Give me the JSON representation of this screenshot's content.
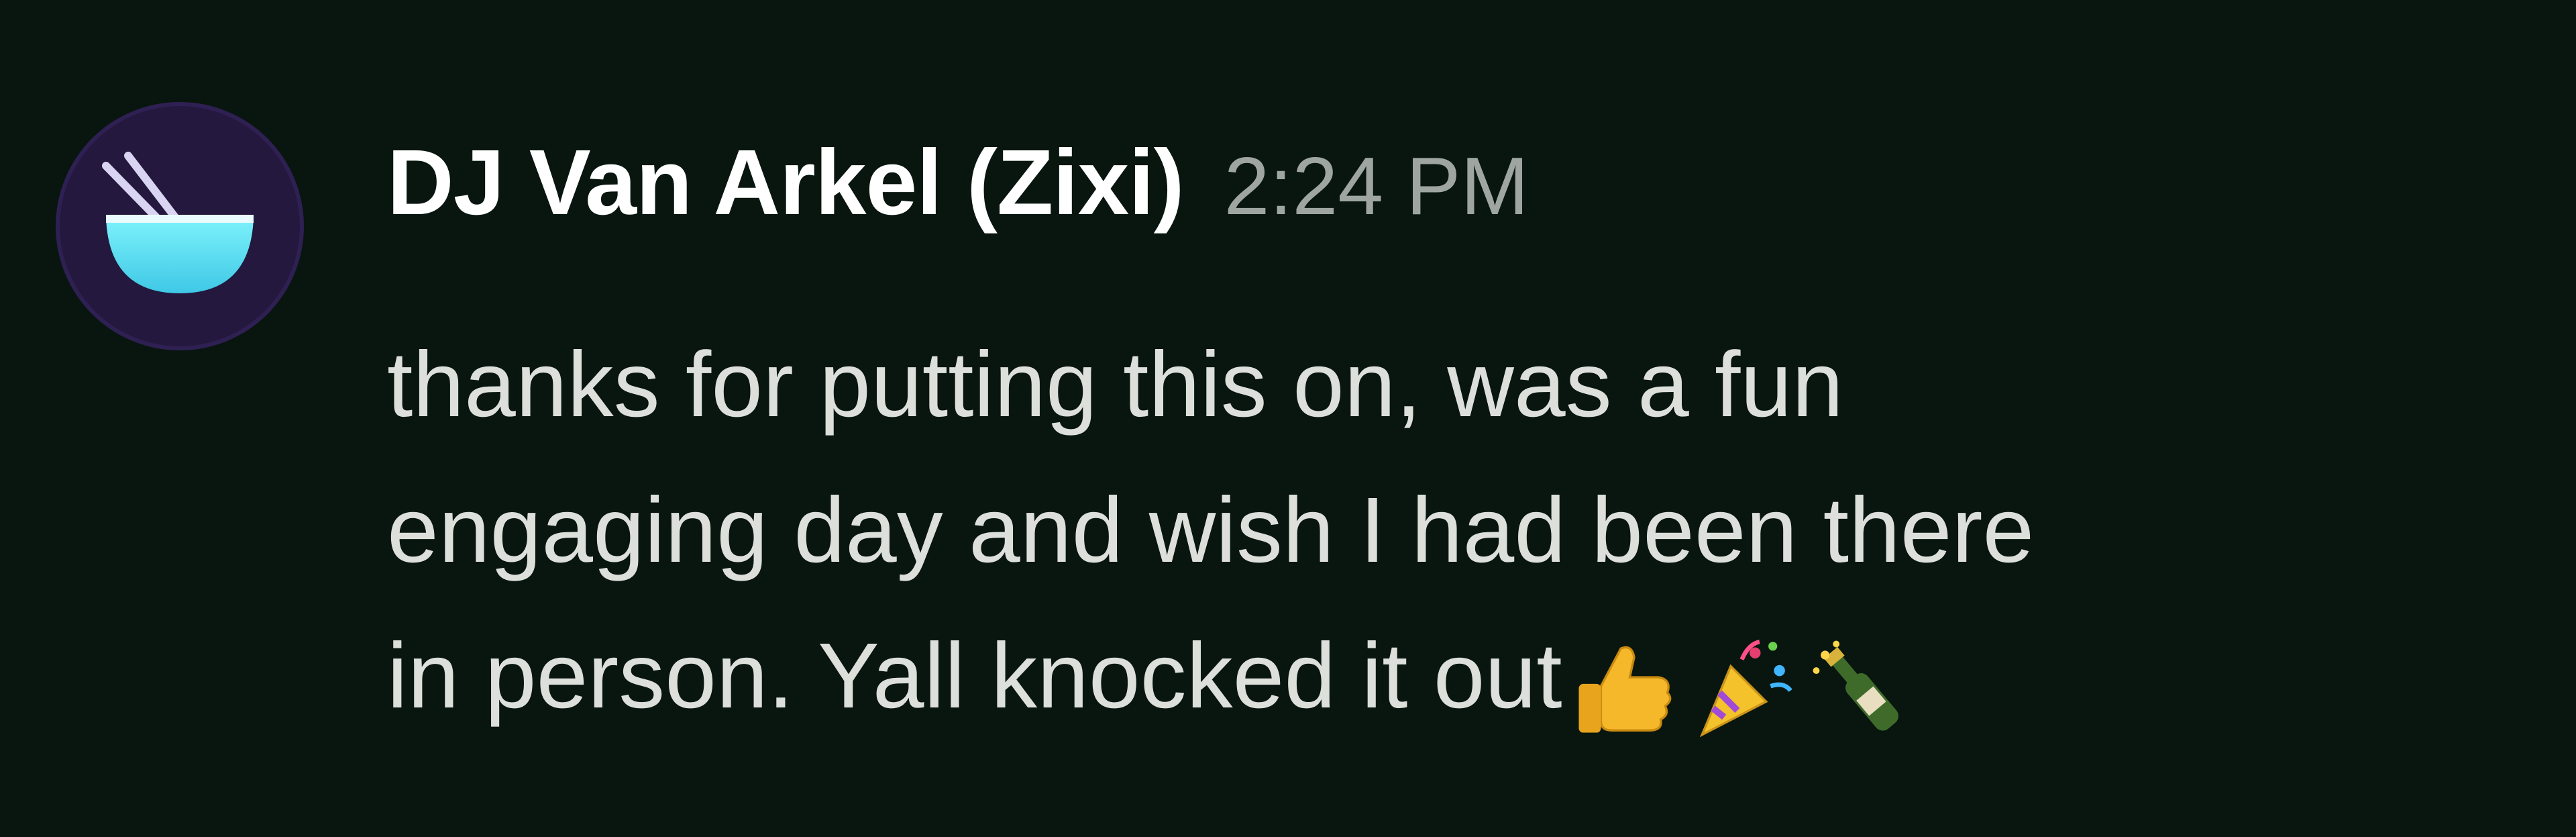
{
  "message": {
    "author": "DJ Van Arkel (Zixi)",
    "timestamp": "2:24 PM",
    "lines": [
      "thanks for putting this on, was a fun",
      "engaging day and wish I had been there",
      "in person. Yall knocked it out"
    ],
    "emojis": [
      "thumbs-up-icon",
      "party-popper-icon",
      "champagne-bottle-icon"
    ],
    "avatar_icon": "bowl-with-chopsticks-icon"
  },
  "colors": {
    "background": "#08160f",
    "author": "#ffffff",
    "timestamp": "#9fa6a2",
    "body": "#dddfdb",
    "avatar_bg": "#24183f",
    "avatar_bowl": "#5ee3f0"
  }
}
